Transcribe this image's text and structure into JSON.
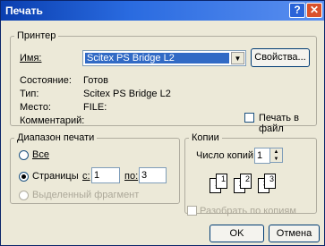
{
  "window": {
    "title": "Печать",
    "help_glyph": "?",
    "close_glyph": "✕"
  },
  "printer": {
    "legend": "Принтер",
    "name_label": "Имя:",
    "name_value": "Scitex PS Bridge L2",
    "properties_button": "Свойства...",
    "status_label": "Состояние:",
    "status_value": "Готов",
    "type_label": "Тип:",
    "type_value": "Scitex PS Bridge L2",
    "where_label": "Место:",
    "where_value": "FILE:",
    "comment_label": "Комментарий:",
    "print_to_file": "Печать в файл"
  },
  "range": {
    "legend": "Диапазон печати",
    "all": "Все",
    "pages": "Страницы",
    "from_label": "с:",
    "from_value": "1",
    "to_label": "по:",
    "to_value": "3",
    "selection": "Выделенный фрагмент",
    "selected_option": "pages"
  },
  "copies": {
    "legend": "Копии",
    "count_label": "Число копий:",
    "count_value": "1",
    "collate": "Разобрать по копиям",
    "pages": [
      "1",
      "1",
      "2",
      "2",
      "3",
      "3"
    ]
  },
  "buttons": {
    "ok": "OK",
    "cancel": "Отмена"
  }
}
